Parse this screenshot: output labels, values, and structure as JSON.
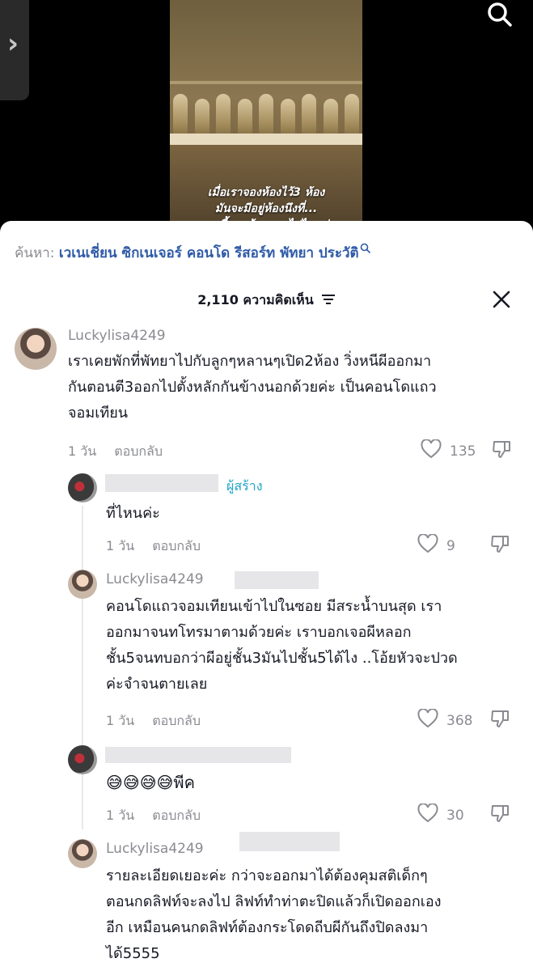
{
  "video": {
    "caption_lines": [
      "เมื่อเราจองห้องไว้3 ห้อง",
      "มันจะมีอยู่ห้องนึงที่...",
      "แบบนี้พระคุ้มครองไปไหมค่ะ"
    ]
  },
  "search": {
    "label": "ค้นหา:",
    "query": "เวเนเชี่ยน ซิกเนเจอร์ คอนโด รีสอร์ท พัทยา ประวัติ"
  },
  "comments_header": {
    "count_text": "2,110 ความคิดเห็น"
  },
  "comments": [
    {
      "username": "Luckylisa4249",
      "text_lines": [
        "เราเคยพักที่พัทยาไปกับลูกๆหลานๆเปิด2ห้อง วิ่งหนีผีออกมา",
        "กันตอนตี3ออกไปตั้งหลักกันข้างนอกด้วยค่ะ เป็นคอนโดแถว",
        "จอมเทียน"
      ],
      "time": "1 วัน",
      "reply_label": "ตอบกลับ",
      "likes": "135"
    }
  ],
  "replies": [
    {
      "username": "",
      "badge": "ผู้สร้าง",
      "text_lines": [
        "ที่ไหนค่ะ"
      ],
      "time": "1 วัน",
      "reply_label": "ตอบกลับ",
      "likes": "9"
    },
    {
      "username": "Luckylisa4249",
      "text_lines": [
        "คอนโดแถวจอมเทียนเข้าไปในซอย มีสระน้ำบนสุด เรา",
        "ออกมาจนทโทรมาตามด้วยค่ะ เราบอกเจอผีหลอก",
        "ชั้น5จนทบอกว่าผีอยู่ชั้น3มันไปชั้น5ได้ไง ..โอ้ยหัวจะปวด",
        "ค่ะจำจนตายเลย"
      ],
      "time": "1 วัน",
      "reply_label": "ตอบกลับ",
      "likes": "368"
    },
    {
      "username": "",
      "text_lines": [
        "😅😅😅😅พีค"
      ],
      "time": "1 วัน",
      "reply_label": "ตอบกลับ",
      "likes": "30"
    },
    {
      "username": "Luckylisa4249",
      "text_lines": [
        "รายละเอียดเยอะค่ะ กว่าจะออกมาได้ต้องคุมสติเด็กๆ",
        "ตอนกดลิฟท์จะลงไป ลิฟท์ทำท่าตะปิดแล้วก็เปิดออกเอง",
        "อีก เหมือนคนกดลิฟท์ต้องกระโดดถีบผีกันถึงปิดลงมา",
        "ได้5555"
      ]
    }
  ],
  "colors": {
    "search_query": "#2f5aa8",
    "creator_badge": "#20a5c8",
    "secondary_text": "#8a8b91"
  },
  "icons": [
    "chevron-right-icon",
    "search-icon",
    "filter-icon",
    "close-icon",
    "heart-icon",
    "dislike-icon"
  ]
}
